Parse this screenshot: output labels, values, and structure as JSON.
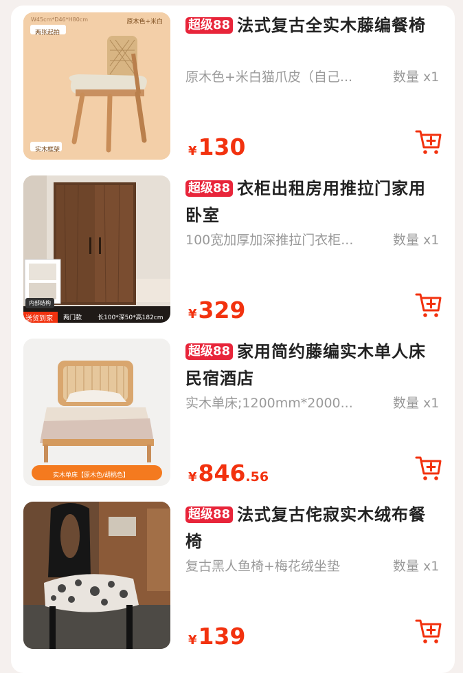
{
  "items": [
    {
      "badge": "超级88",
      "title": "法式复古全实木藤编餐椅",
      "spec": "原木色+米白猫爪皮（自己...",
      "qty": "数量 x1",
      "currency": "¥",
      "price_int": "130",
      "price_dec": "",
      "thumb_tags": [
        "两张起拍",
        "原木色+米白",
        "W45cm*D46*H80cm",
        "实木框架"
      ]
    },
    {
      "badge": "超级88",
      "title": "衣柜出租房用推拉门家用卧室",
      "spec": "100宽加厚加深推拉门衣柜...",
      "qty": "数量 x1",
      "currency": "¥",
      "price_int": "329",
      "price_dec": "",
      "thumb_tags": [
        "内部结构",
        "送货到家",
        "两门款",
        "长100*深50*高182cm"
      ]
    },
    {
      "badge": "超级88",
      "title": "家用简约藤编实木单人床民宿酒店",
      "spec": "实木单床;1200mm*2000...",
      "qty": "数量 x1",
      "currency": "¥",
      "price_int": "846",
      "price_dec": ".56",
      "thumb_tags": [
        "实木单床【原木色/胡桃色】"
      ]
    },
    {
      "badge": "超级88",
      "title": "法式复古侘寂实木绒布餐椅",
      "spec": "复古黑人鱼椅+梅花绒坐垫",
      "qty": "数量 x1",
      "currency": "¥",
      "price_int": "139",
      "price_dec": "",
      "thumb_tags": []
    }
  ],
  "colors": {
    "badge_bg": "#e8253a",
    "price": "#f2320f",
    "cart_icon": "#f2320f",
    "muted_text": "#9a9a9a"
  },
  "icons": {
    "cart": "add-to-cart-icon"
  }
}
